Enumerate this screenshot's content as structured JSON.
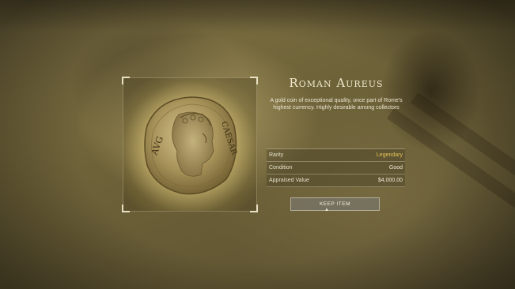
{
  "item": {
    "title": "Roman Aureus",
    "description": "A gold coin of exceptional quality, once part of Rome's highest currency. Highly desirable among collectors",
    "coin_inscription_left": "AVG",
    "coin_inscription_right": "CAESAR"
  },
  "stats": [
    {
      "label": "Rarity",
      "value": "Legendary",
      "highlight": true
    },
    {
      "label": "Condition",
      "value": "Good",
      "highlight": false
    },
    {
      "label": "Appraised Value",
      "value": "$4,000.00",
      "highlight": false
    }
  ],
  "actions": {
    "keep_label": "KEEP ITEM"
  },
  "colors": {
    "legendary": "#e6c757",
    "gold": "#c9b26a",
    "panel_text": "#efe7cb"
  },
  "icons": {
    "cursor": "mouse-cursor-icon"
  }
}
